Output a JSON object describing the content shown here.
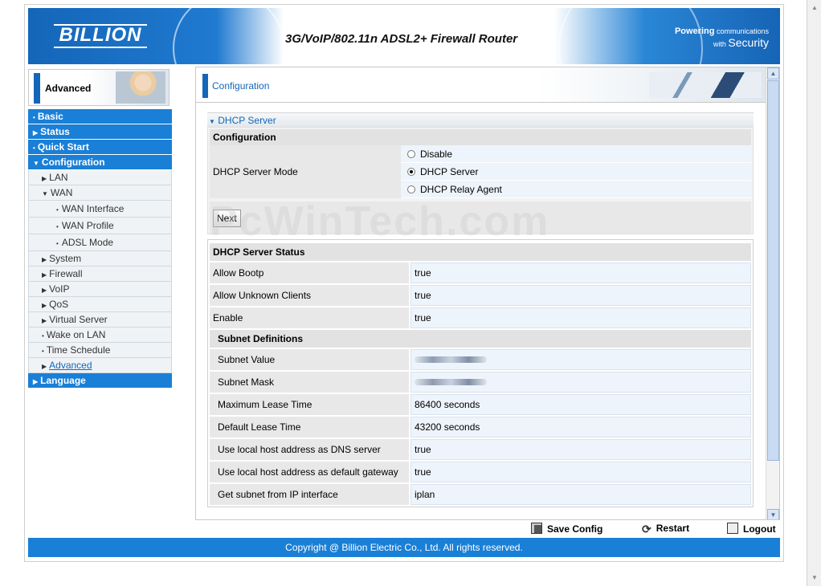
{
  "header": {
    "logo": "BILLION",
    "product_title": "3G/VoIP/802.11n ADSL2+ Firewall Router",
    "tagline_line1_bold": "Powering",
    "tagline_line1_small": " communications",
    "tagline_line2_small": "with ",
    "tagline_line2": "Security"
  },
  "nav_header": {
    "label": "Advanced"
  },
  "nav": {
    "items": [
      {
        "label": "Basic",
        "level": 0
      },
      {
        "label": "Status",
        "level": 0
      },
      {
        "label": "Quick Start",
        "level": 0
      },
      {
        "label": "Configuration",
        "level": 0
      },
      {
        "label": "LAN",
        "level": 1
      },
      {
        "label": "WAN",
        "level": 1
      },
      {
        "label": "WAN Interface",
        "level": 2
      },
      {
        "label": "WAN Profile",
        "level": 2
      },
      {
        "label": "ADSL Mode",
        "level": 2
      },
      {
        "label": "System",
        "level": 1
      },
      {
        "label": "Firewall",
        "level": 1
      },
      {
        "label": "VoIP",
        "level": 1
      },
      {
        "label": "QoS",
        "level": 1
      },
      {
        "label": "Virtual Server",
        "level": 1
      },
      {
        "label": "Wake on LAN",
        "level": 1
      },
      {
        "label": "Time Schedule",
        "level": 1
      },
      {
        "label": "Advanced",
        "level": 1
      },
      {
        "label": "Language",
        "level": 0
      }
    ]
  },
  "main": {
    "title": "Configuration",
    "section": "DHCP Server",
    "config_head": "Configuration",
    "mode_label": "DHCP Server Mode",
    "options": [
      "Disable",
      "DHCP Server",
      "DHCP Relay Agent"
    ],
    "selected_option": "DHCP Server",
    "next_label": "Next",
    "status_head": "DHCP Server Status",
    "status_rows": [
      {
        "key": "Allow Bootp",
        "value": "true"
      },
      {
        "key": "Allow Unknown Clients",
        "value": "true"
      },
      {
        "key": "Enable",
        "value": "true"
      }
    ],
    "subnet_head": "Subnet Definitions",
    "subnet_rows": [
      {
        "key": "Subnet Value",
        "value": ""
      },
      {
        "key": "Subnet Mask",
        "value": ""
      },
      {
        "key": "Maximum Lease Time",
        "value": "86400 seconds"
      },
      {
        "key": "Default Lease Time",
        "value": "43200 seconds"
      },
      {
        "key": "Use local host address as DNS server",
        "value": "true"
      },
      {
        "key": "Use local host address as default gateway",
        "value": "true"
      },
      {
        "key": "Get subnet from IP interface",
        "value": "iplan"
      }
    ]
  },
  "toolbar": {
    "save": "Save Config",
    "restart": "Restart",
    "logout": "Logout"
  },
  "footer": {
    "copyright": "Copyright @ Billion Electric Co., Ltd. All rights reserved."
  },
  "watermark": "PcWinTech.com",
  "colors": {
    "brand_blue": "#1a7fd6",
    "link_blue": "#1466b8"
  }
}
